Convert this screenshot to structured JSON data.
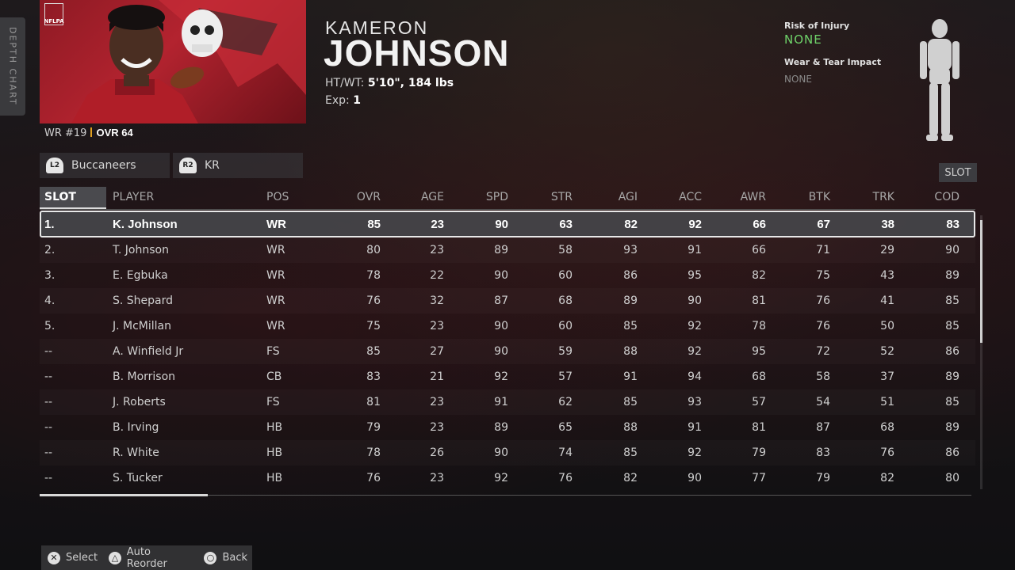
{
  "side_tab": {
    "label": "DEPTH CHART"
  },
  "portrait_badge": "NFLPA",
  "player": {
    "position": "WR #19",
    "ovr": "OVR 64",
    "first_name": "KAMERON",
    "last_name": "JOHNSON",
    "htwt_label": "HT/WT:",
    "htwt_value": "5'10\", 184 lbs",
    "exp_label": "Exp:",
    "exp_value": "1"
  },
  "nav": {
    "team_trigger": "L2",
    "team_label": "Buccaneers",
    "slot_trigger": "R2",
    "slot_label": "KR"
  },
  "injury": {
    "risk_label": "Risk of Injury",
    "risk_value": "NONE",
    "wear_label": "Wear & Tear Impact",
    "wear_value": "NONE",
    "risk_color": "#6fd36a"
  },
  "slot_button": "SLOT",
  "table": {
    "headers": [
      "SLOT",
      "PLAYER",
      "POS",
      "OVR",
      "AGE",
      "SPD",
      "STR",
      "AGI",
      "ACC",
      "AWR",
      "BTK",
      "TRK",
      "COD"
    ],
    "rows": [
      [
        "1.",
        "K. Johnson",
        "WR",
        "85",
        "23",
        "90",
        "63",
        "82",
        "92",
        "66",
        "67",
        "38",
        "83"
      ],
      [
        "2.",
        "T. Johnson",
        "WR",
        "80",
        "23",
        "89",
        "58",
        "93",
        "91",
        "66",
        "71",
        "29",
        "90"
      ],
      [
        "3.",
        "E. Egbuka",
        "WR",
        "78",
        "22",
        "90",
        "60",
        "86",
        "95",
        "82",
        "75",
        "43",
        "89"
      ],
      [
        "4.",
        "S. Shepard",
        "WR",
        "76",
        "32",
        "87",
        "68",
        "89",
        "90",
        "81",
        "76",
        "41",
        "85"
      ],
      [
        "5.",
        "J. McMillan",
        "WR",
        "75",
        "23",
        "90",
        "60",
        "85",
        "92",
        "78",
        "76",
        "50",
        "85"
      ],
      [
        "--",
        "A. Winfield Jr",
        "FS",
        "85",
        "27",
        "90",
        "59",
        "88",
        "92",
        "95",
        "72",
        "52",
        "86"
      ],
      [
        "--",
        "B. Morrison",
        "CB",
        "83",
        "21",
        "92",
        "57",
        "91",
        "94",
        "68",
        "58",
        "37",
        "89"
      ],
      [
        "--",
        "J. Roberts",
        "FS",
        "81",
        "23",
        "91",
        "62",
        "85",
        "93",
        "57",
        "54",
        "51",
        "85"
      ],
      [
        "--",
        "B. Irving",
        "HB",
        "79",
        "23",
        "89",
        "65",
        "88",
        "91",
        "81",
        "87",
        "68",
        "89"
      ],
      [
        "--",
        "R. White",
        "HB",
        "78",
        "26",
        "90",
        "74",
        "85",
        "92",
        "79",
        "83",
        "76",
        "86"
      ],
      [
        "--",
        "S. Tucker",
        "HB",
        "76",
        "23",
        "92",
        "76",
        "82",
        "90",
        "77",
        "79",
        "82",
        "80"
      ]
    ],
    "selected_index": 0
  },
  "footer": {
    "select_glyph": "✕",
    "select_label": "Select",
    "reorder_glyph": "△",
    "reorder_label": "Auto Reorder",
    "back_glyph": "○",
    "back_label": "Back"
  }
}
